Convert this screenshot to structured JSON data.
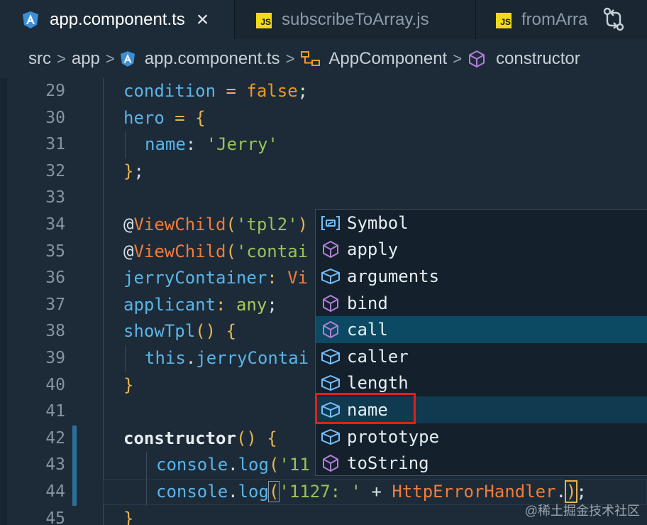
{
  "tabs": [
    {
      "label": "app.component.ts",
      "icon": "angular-icon",
      "active": true,
      "close": "×"
    },
    {
      "label": "subscribeToArray.js",
      "icon": "js-icon",
      "badge": "JS"
    },
    {
      "label": "fromArra",
      "icon": "js-icon",
      "badge": "JS"
    }
  ],
  "breadcrumb": {
    "src": "src",
    "app": "app",
    "file": "app.component.ts",
    "class": "AppComponent",
    "member": "constructor",
    "sep": ">"
  },
  "editor": {
    "lines": [
      {
        "num": "29"
      },
      {
        "num": "30"
      },
      {
        "num": "31"
      },
      {
        "num": "32"
      },
      {
        "num": "33"
      },
      {
        "num": "34"
      },
      {
        "num": "35"
      },
      {
        "num": "36"
      },
      {
        "num": "37"
      },
      {
        "num": "38"
      },
      {
        "num": "39"
      },
      {
        "num": "40"
      },
      {
        "num": "41"
      },
      {
        "num": "42"
      },
      {
        "num": "43"
      },
      {
        "num": "44"
      },
      {
        "num": "45"
      }
    ],
    "code": {
      "l29": [
        "condition",
        " = ",
        "false",
        ";"
      ],
      "l30": [
        "hero",
        " = ",
        "{"
      ],
      "l31": [
        "name",
        ": ",
        "'Jerry'"
      ],
      "l32": [
        "}",
        ";"
      ],
      "l34": [
        "@",
        "ViewChild",
        "(",
        "'tpl2'",
        ")"
      ],
      "l35": [
        "@",
        "ViewChild",
        "(",
        "'contai"
      ],
      "l36": [
        "jerryContainer",
        ": ",
        "Vi"
      ],
      "l37": [
        "applicant",
        ": ",
        "any",
        ";"
      ],
      "l38": [
        "showTpl",
        "()",
        " {"
      ],
      "l39": [
        "this",
        ".",
        "jerryContai"
      ],
      "l40": [
        "}"
      ],
      "l42": [
        "constructor",
        "()",
        " {"
      ],
      "l43": [
        "console",
        ".",
        "log",
        "(",
        "'11"
      ],
      "l44": [
        "console",
        ".",
        "log",
        "(",
        "'1127: '",
        " + ",
        "HttpErrorHandler",
        ".",
        ")",
        ";"
      ],
      "l45": [
        "}"
      ]
    }
  },
  "suggest": {
    "items": [
      {
        "label": "Symbol",
        "icon": "field-icon"
      },
      {
        "label": "apply",
        "icon": "method-icon"
      },
      {
        "label": "arguments",
        "icon": "property-icon"
      },
      {
        "label": "bind",
        "icon": "method-icon"
      },
      {
        "label": "call",
        "icon": "method-icon"
      },
      {
        "label": "caller",
        "icon": "property-icon"
      },
      {
        "label": "length",
        "icon": "property-icon"
      },
      {
        "label": "name",
        "icon": "property-icon"
      },
      {
        "label": "prototype",
        "icon": "property-icon"
      },
      {
        "label": "toString",
        "icon": "method-icon"
      }
    ],
    "selected": "call",
    "highlighted": "name"
  },
  "colors": {
    "accent_selected": "#0c4a63",
    "highlight_border": "#e0201b",
    "method_icon": "#b180d7",
    "property_icon": "#75beff"
  },
  "watermark": "@稀土掘金技术社区"
}
